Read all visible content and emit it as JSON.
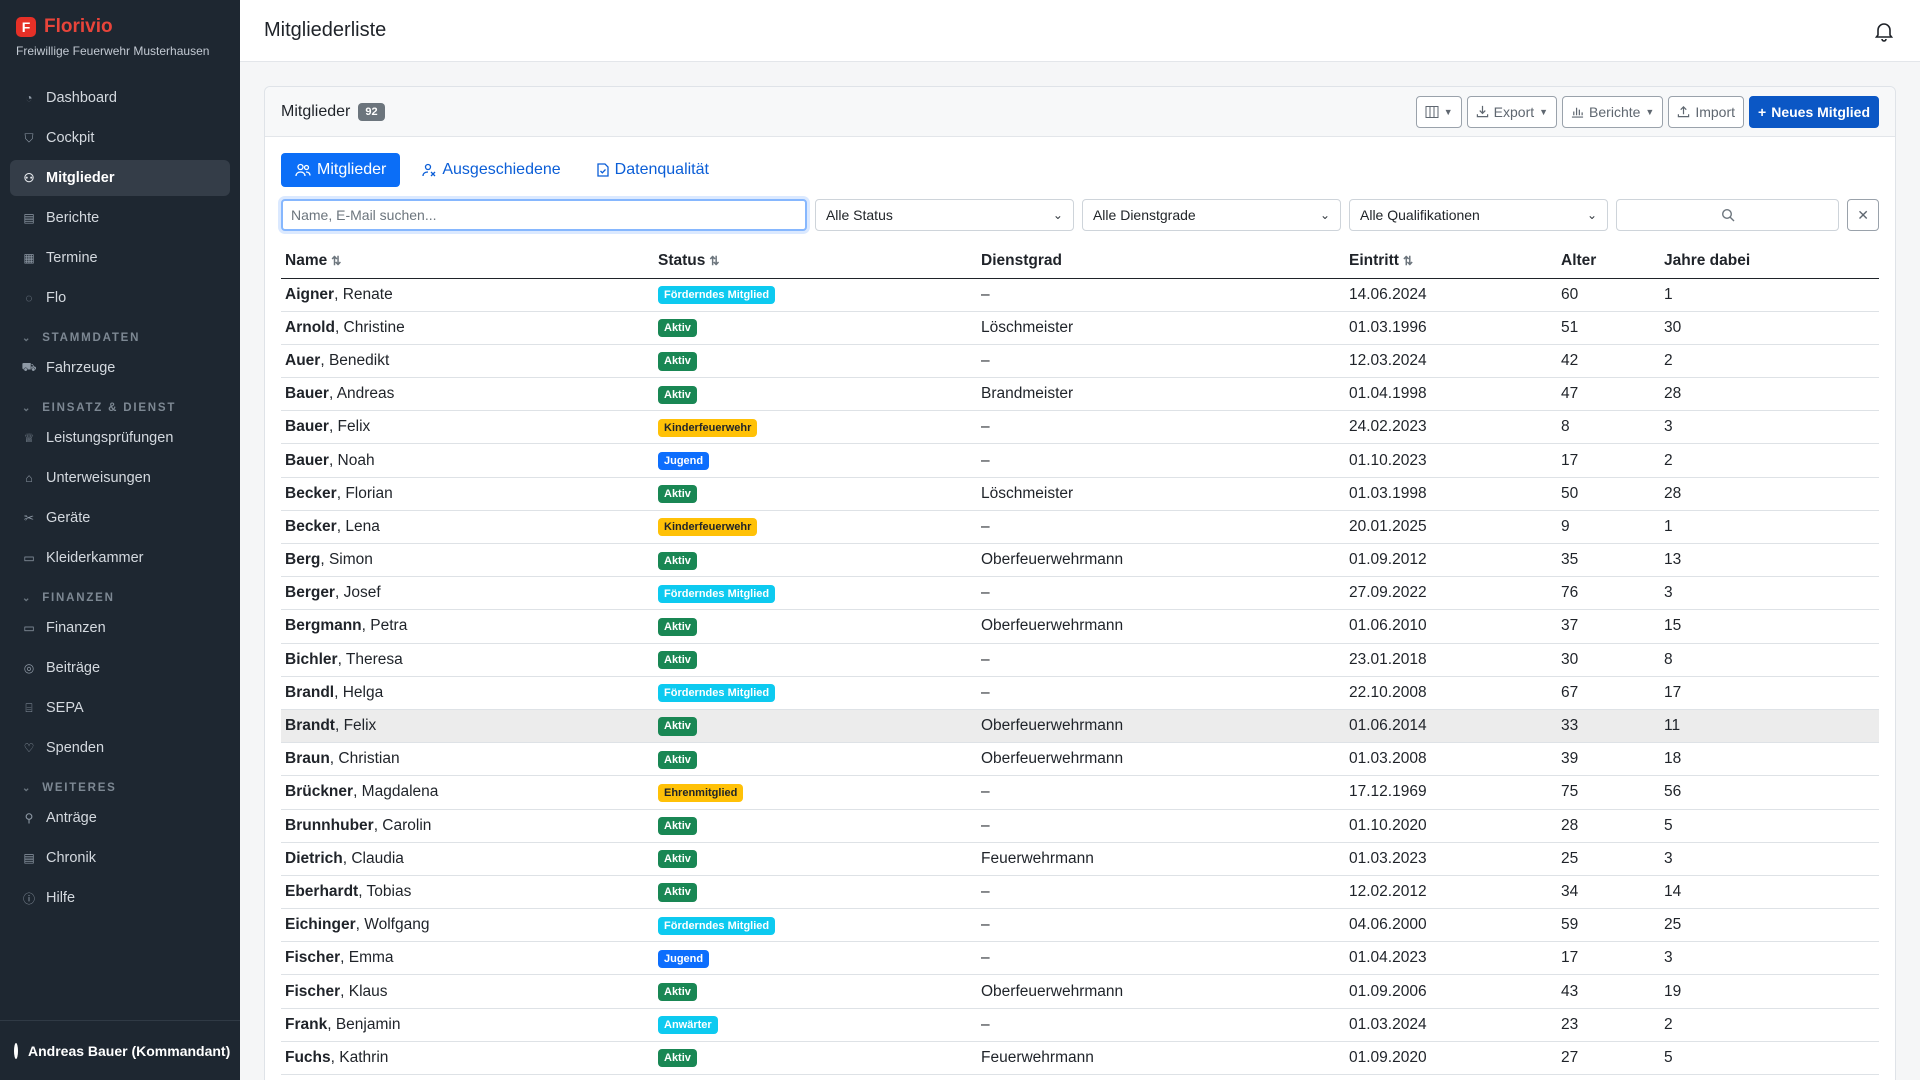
{
  "brand": {
    "name": "Florivio",
    "logo_letter": "F",
    "org": "Freiwillige Feuerwehr Musterhausen"
  },
  "nav": {
    "top": [
      {
        "label": "Dashboard",
        "icon": "gauge-icon"
      },
      {
        "label": "Cockpit",
        "icon": "shield-icon"
      },
      {
        "label": "Mitglieder",
        "icon": "users-icon",
        "active": true
      },
      {
        "label": "Berichte",
        "icon": "document-icon"
      },
      {
        "label": "Termine",
        "icon": "calendar-icon"
      },
      {
        "label": "Flo",
        "icon": "chat-icon"
      }
    ],
    "sections": [
      {
        "title": "STAMMDATEN",
        "items": [
          {
            "label": "Fahrzeuge",
            "icon": "truck-icon"
          }
        ]
      },
      {
        "title": "EINSATZ & DIENST",
        "items": [
          {
            "label": "Leistungsprüfungen",
            "icon": "trophy-icon"
          },
          {
            "label": "Unterweisungen",
            "icon": "graduation-icon"
          },
          {
            "label": "Geräte",
            "icon": "tools-icon"
          },
          {
            "label": "Kleiderkammer",
            "icon": "box-icon"
          }
        ]
      },
      {
        "title": "FINANZEN",
        "items": [
          {
            "label": "Finanzen",
            "icon": "wallet-icon"
          },
          {
            "label": "Beiträge",
            "icon": "coins-icon"
          },
          {
            "label": "SEPA",
            "icon": "bank-icon"
          },
          {
            "label": "Spenden",
            "icon": "heart-icon"
          }
        ]
      },
      {
        "title": "WEITERES",
        "items": [
          {
            "label": "Anträge",
            "icon": "person-add-icon"
          },
          {
            "label": "Chronik",
            "icon": "book-icon"
          },
          {
            "label": "Hilfe",
            "icon": "help-icon"
          }
        ]
      }
    ]
  },
  "user": {
    "label": "Andreas Bauer (Kommandant)"
  },
  "header": {
    "title": "Mitgliederliste"
  },
  "card": {
    "title": "Mitglieder",
    "count": "92",
    "toolbar": {
      "export": "Export",
      "reports": "Berichte",
      "import": "Import",
      "new_member": "Neues Mitglied"
    }
  },
  "tabs": [
    {
      "label": "Mitglieder",
      "active": true
    },
    {
      "label": "Ausgeschiedene"
    },
    {
      "label": "Datenqualität"
    }
  ],
  "filters": {
    "search_placeholder": "Name, E-Mail suchen...",
    "status": "Alle Status",
    "rank": "Alle Dienstgrade",
    "qualification": "Alle Qualifikationen"
  },
  "table": {
    "columns": [
      "Name",
      "Status",
      "Dienstgrad",
      "Eintritt",
      "Alter",
      "Jahre dabei"
    ],
    "rows": [
      {
        "last": "Aigner",
        "first": ", Renate",
        "status": "Förderndes Mitglied",
        "type": "foerdernd",
        "rank": "–",
        "entry": "14.06.2024",
        "age": "60",
        "years": "1"
      },
      {
        "last": "Arnold",
        "first": ", Christine",
        "status": "Aktiv",
        "type": "aktiv",
        "rank": "Löschmeister",
        "entry": "01.03.1996",
        "age": "51",
        "years": "30"
      },
      {
        "last": "Auer",
        "first": ", Benedikt",
        "status": "Aktiv",
        "type": "aktiv",
        "rank": "–",
        "entry": "12.03.2024",
        "age": "42",
        "years": "2"
      },
      {
        "last": "Bauer",
        "first": ", Andreas",
        "status": "Aktiv",
        "type": "aktiv",
        "rank": "Brandmeister",
        "entry": "01.04.1998",
        "age": "47",
        "years": "28"
      },
      {
        "last": "Bauer",
        "first": ", Felix",
        "status": "Kinderfeuerwehr",
        "type": "kinder",
        "rank": "–",
        "entry": "24.02.2023",
        "age": "8",
        "years": "3"
      },
      {
        "last": "Bauer",
        "first": ", Noah",
        "status": "Jugend",
        "type": "jugend",
        "rank": "–",
        "entry": "01.10.2023",
        "age": "17",
        "years": "2"
      },
      {
        "last": "Becker",
        "first": ", Florian",
        "status": "Aktiv",
        "type": "aktiv",
        "rank": "Löschmeister",
        "entry": "01.03.1998",
        "age": "50",
        "years": "28"
      },
      {
        "last": "Becker",
        "first": ", Lena",
        "status": "Kinderfeuerwehr",
        "type": "kinder",
        "rank": "–",
        "entry": "20.01.2025",
        "age": "9",
        "years": "1"
      },
      {
        "last": "Berg",
        "first": ", Simon",
        "status": "Aktiv",
        "type": "aktiv",
        "rank": "Oberfeuerwehrmann",
        "entry": "01.09.2012",
        "age": "35",
        "years": "13"
      },
      {
        "last": "Berger",
        "first": ", Josef",
        "status": "Förderndes Mitglied",
        "type": "foerdernd",
        "rank": "–",
        "entry": "27.09.2022",
        "age": "76",
        "years": "3"
      },
      {
        "last": "Bergmann",
        "first": ", Petra",
        "status": "Aktiv",
        "type": "aktiv",
        "rank": "Oberfeuerwehrmann",
        "entry": "01.06.2010",
        "age": "37",
        "years": "15"
      },
      {
        "last": "Bichler",
        "first": ", Theresa",
        "status": "Aktiv",
        "type": "aktiv",
        "rank": "–",
        "entry": "23.01.2018",
        "age": "30",
        "years": "8"
      },
      {
        "last": "Brandl",
        "first": ", Helga",
        "status": "Förderndes Mitglied",
        "type": "foerdernd",
        "rank": "–",
        "entry": "22.10.2008",
        "age": "67",
        "years": "17"
      },
      {
        "last": "Brandt",
        "first": ", Felix",
        "status": "Aktiv",
        "type": "aktiv",
        "rank": "Oberfeuerwehrmann",
        "entry": "01.06.2014",
        "age": "33",
        "years": "11",
        "highlight": true
      },
      {
        "last": "Braun",
        "first": ", Christian",
        "status": "Aktiv",
        "type": "aktiv",
        "rank": "Oberfeuerwehrmann",
        "entry": "01.03.2008",
        "age": "39",
        "years": "18"
      },
      {
        "last": "Brückner",
        "first": ", Magdalena",
        "status": "Ehrenmitglied",
        "type": "ehren",
        "rank": "–",
        "entry": "17.12.1969",
        "age": "75",
        "years": "56"
      },
      {
        "last": "Brunnhuber",
        "first": ", Carolin",
        "status": "Aktiv",
        "type": "aktiv",
        "rank": "–",
        "entry": "01.10.2020",
        "age": "28",
        "years": "5"
      },
      {
        "last": "Dietrich",
        "first": ", Claudia",
        "status": "Aktiv",
        "type": "aktiv",
        "rank": "Feuerwehrmann",
        "entry": "01.03.2023",
        "age": "25",
        "years": "3"
      },
      {
        "last": "Eberhardt",
        "first": ", Tobias",
        "status": "Aktiv",
        "type": "aktiv",
        "rank": "–",
        "entry": "12.02.2012",
        "age": "34",
        "years": "14"
      },
      {
        "last": "Eichinger",
        "first": ", Wolfgang",
        "status": "Förderndes Mitglied",
        "type": "foerdernd",
        "rank": "–",
        "entry": "04.06.2000",
        "age": "59",
        "years": "25"
      },
      {
        "last": "Fischer",
        "first": ", Emma",
        "status": "Jugend",
        "type": "jugend",
        "rank": "–",
        "entry": "01.04.2023",
        "age": "17",
        "years": "3"
      },
      {
        "last": "Fischer",
        "first": ", Klaus",
        "status": "Aktiv",
        "type": "aktiv",
        "rank": "Oberfeuerwehrmann",
        "entry": "01.09.2006",
        "age": "43",
        "years": "19"
      },
      {
        "last": "Frank",
        "first": ", Benjamin",
        "status": "Anwärter",
        "type": "anwaerter",
        "rank": "–",
        "entry": "01.03.2024",
        "age": "23",
        "years": "2"
      },
      {
        "last": "Fuchs",
        "first": ", Kathrin",
        "status": "Aktiv",
        "type": "aktiv",
        "rank": "Feuerwehrmann",
        "entry": "01.09.2020",
        "age": "27",
        "years": "5"
      }
    ]
  },
  "colors": {
    "sidebar": "#1e2731",
    "primary": "#0b57c5",
    "brand": "#e8443a",
    "aktiv": "#198754",
    "foerdernd": "#0dcaf0",
    "jugend": "#0d6efd",
    "kinder": "#ffc107"
  }
}
